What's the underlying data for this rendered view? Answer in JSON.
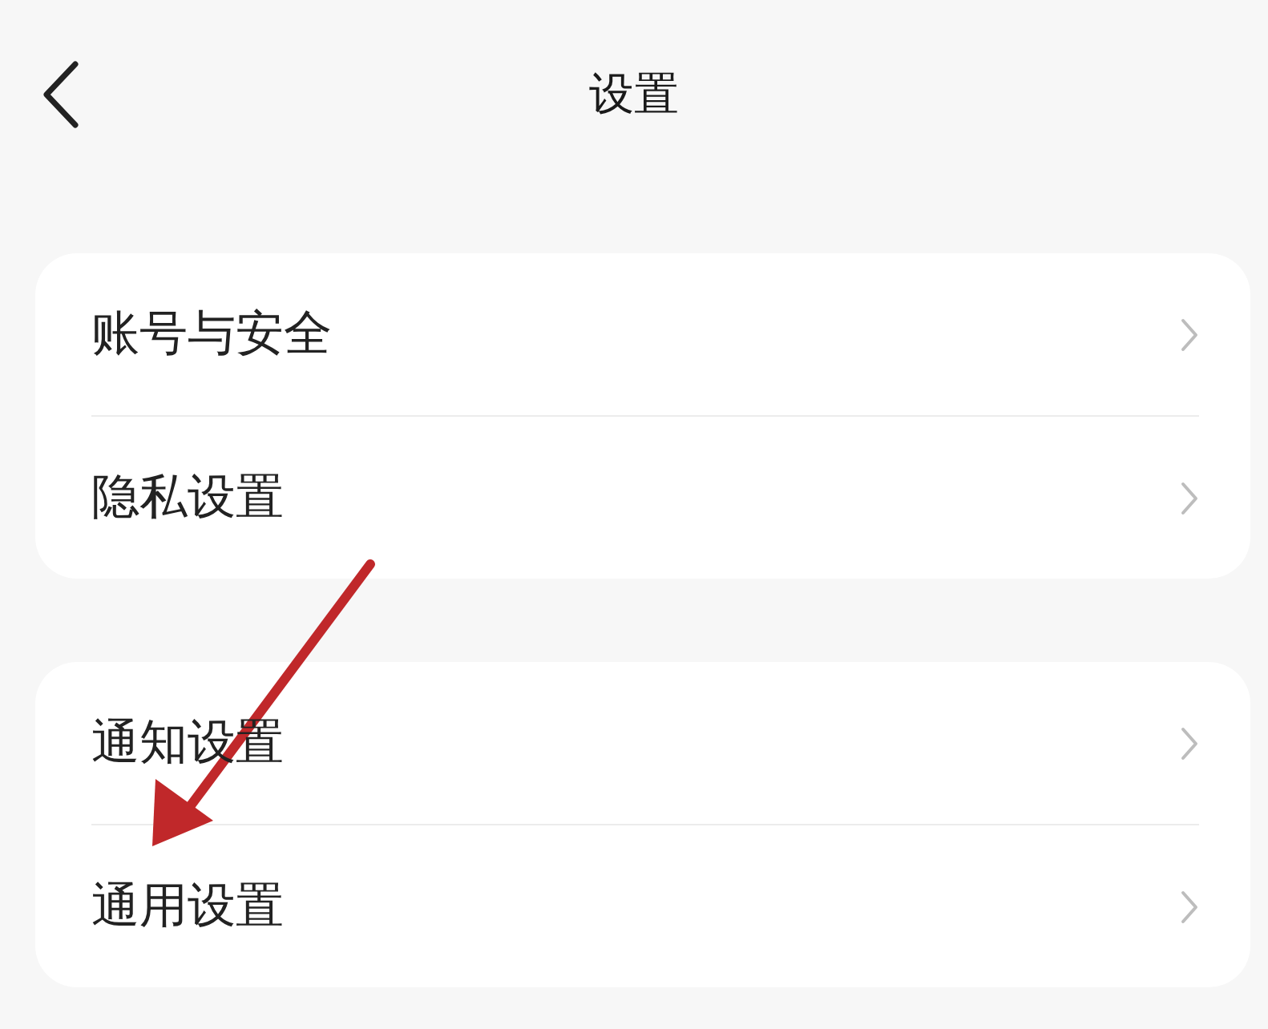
{
  "header": {
    "title": "设置"
  },
  "groups": [
    {
      "items": [
        {
          "label": "账号与安全"
        },
        {
          "label": "隐私设置"
        }
      ]
    },
    {
      "items": [
        {
          "label": "通知设置"
        },
        {
          "label": "通用设置"
        }
      ]
    }
  ]
}
